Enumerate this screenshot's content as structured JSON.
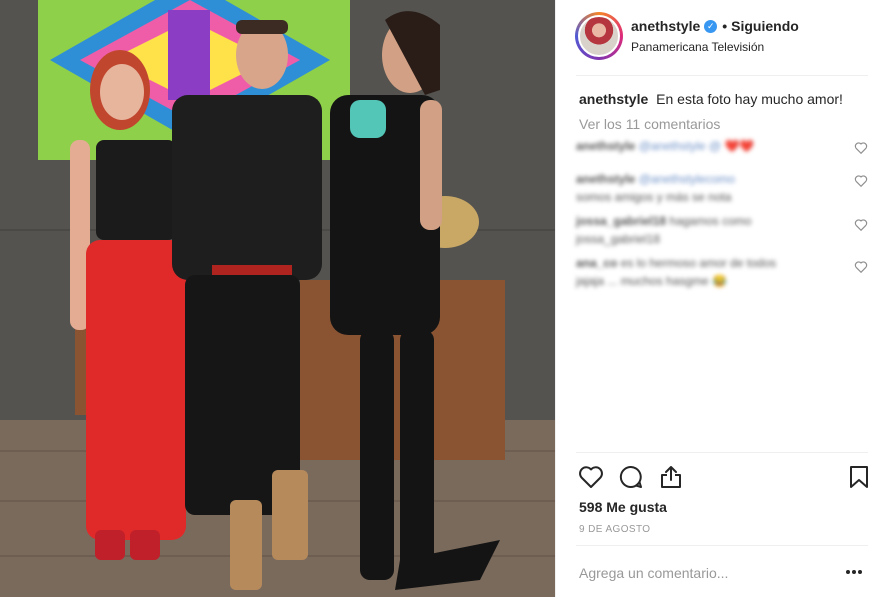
{
  "post": {
    "username": "anethstyle",
    "follow_separator": "•",
    "follow_status": "Siguiendo",
    "location": "Panamericana Televisión",
    "caption_user": "anethstyle",
    "caption_text": "En esta foto hay mucho amor!",
    "view_comments": "Ver los 11 comentarios",
    "likes": "598 Me gusta",
    "date": "9 DE AGOSTO",
    "add_comment_placeholder": "Agrega un comentario..."
  },
  "comments": [
    {
      "user": "anethstyle",
      "text": "@anethstyle @ ❤️❤️"
    },
    {
      "user": "anethstyle",
      "text": "@anethstylecomo",
      "line2": "somos amigos y más se nota"
    },
    {
      "user": "jossa_gabriel18",
      "text": "hagamos como",
      "line2": "jossa_gabriel18"
    },
    {
      "user": "ana_co",
      "text": "es lo hermoso amor de todos",
      "line2": "jajaja ... muchos hasgme 😂"
    }
  ],
  "icons": {
    "verified": "verified-badge-icon",
    "like": "heart-icon",
    "comment": "comment-bubble-icon",
    "share": "share-icon",
    "save": "bookmark-icon",
    "more": "more-options-icon"
  },
  "colors": {
    "verified": "#3897f0",
    "muted_text": "#999999",
    "divider": "#efefef"
  }
}
